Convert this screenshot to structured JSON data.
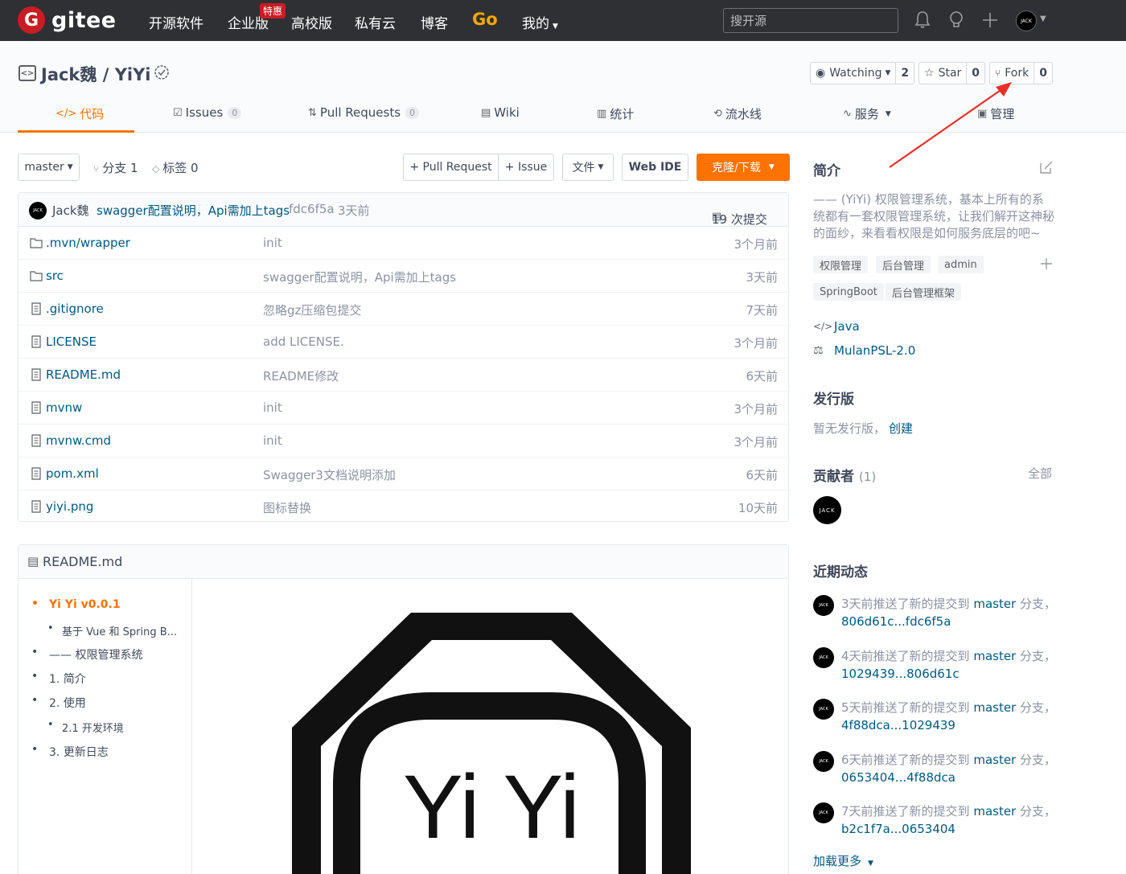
{
  "nav": {
    "logo_text": "gitee",
    "items": [
      "开源软件",
      "企业版",
      "高校版",
      "私有云",
      "博客",
      "Go",
      "我的"
    ],
    "badge": "特惠",
    "search_placeholder": "搜开源",
    "avatar_text": "JACK"
  },
  "repo": {
    "title": "Jack魏 / YiYi",
    "watching_label": "Watching",
    "watching_count": "2",
    "star_label": "Star",
    "star_count": "0",
    "fork_label": "Fork",
    "fork_count": "0"
  },
  "tabs": [
    {
      "label": "代码",
      "icon": "</>"
    },
    {
      "label": "Issues",
      "count": "0"
    },
    {
      "label": "Pull Requests",
      "count": "0"
    },
    {
      "label": "Wiki"
    },
    {
      "label": "统计"
    },
    {
      "label": "流水线"
    },
    {
      "label": "服务"
    },
    {
      "label": "管理"
    }
  ],
  "toolbar": {
    "branch": "master",
    "branches": "分支 1",
    "tags": "标签 0",
    "pull_request": "+ Pull Request",
    "issue": "+ Issue",
    "file": "文件",
    "web_ide": "Web IDE",
    "clone": "克隆/下载"
  },
  "commit": {
    "author": "Jack魏",
    "message": "swagger配置说明，Api需加上tags",
    "hash": "fdc6f5a",
    "time": "3天前",
    "count": "19 次提交"
  },
  "files": [
    {
      "type": "folder",
      "name": ".mvn/wrapper",
      "message": "init",
      "time": "3个月前"
    },
    {
      "type": "folder",
      "name": "src",
      "message": "swagger配置说明，Api需加上tags",
      "time": "3天前"
    },
    {
      "type": "file",
      "name": ".gitignore",
      "message": "忽略gz压缩包提交",
      "time": "7天前"
    },
    {
      "type": "file",
      "name": "LICENSE",
      "message": "add LICENSE.",
      "time": "3个月前"
    },
    {
      "type": "file",
      "name": "README.md",
      "message": "README修改",
      "time": "6天前"
    },
    {
      "type": "file",
      "name": "mvnw",
      "message": "init",
      "time": "3个月前"
    },
    {
      "type": "file",
      "name": "mvnw.cmd",
      "message": "init",
      "time": "3个月前"
    },
    {
      "type": "file",
      "name": "pom.xml",
      "message": "Swagger3文档说明添加",
      "time": "6天前"
    },
    {
      "type": "file",
      "name": "yiyi.png",
      "message": "图标替换",
      "time": "10天前"
    }
  ],
  "readme": {
    "title": "README.md",
    "toc": [
      {
        "label": "Yi Yi v0.0.1",
        "level": 1,
        "active": true
      },
      {
        "label": "基于 Vue 和 Spring B...",
        "level": 2
      },
      {
        "label": "—— 权限管理系统",
        "level": 1
      },
      {
        "label": "1. 简介",
        "level": 1
      },
      {
        "label": "2. 使用",
        "level": 1
      },
      {
        "label": "2.1 开发环境",
        "level": 2
      },
      {
        "label": "3. 更新日志",
        "level": 1
      }
    ],
    "image_text": "Yi Yi"
  },
  "sidebar": {
    "intro_title": "简介",
    "intro": "—— (YiYi) 权限管理系统，基本上所有的系统都有一套权限管理系统，让我们解开这神秘的面纱，来看看权限是如何服务底层的吧~",
    "tags": [
      "权限管理",
      "后台管理",
      "admin",
      "SpringBoot",
      "后台管理框架"
    ],
    "language": "Java",
    "license": "MulanPSL-2.0",
    "release_title": "发行版",
    "release_text": "暂无发行版，",
    "release_create": "创建",
    "contrib_title": "贡献者",
    "contrib_count": "(1)",
    "contrib_all": "全部",
    "contrib_avatar": "JACK",
    "activity_title": "近期动态",
    "activities": [
      {
        "prefix": "3天前推送了新的提交到 ",
        "branch": "master",
        "mid": " 分支，",
        "range": "806d61c...fdc6f5a"
      },
      {
        "prefix": "4天前推送了新的提交到 ",
        "branch": "master",
        "mid": " 分支，",
        "range": "1029439...806d61c"
      },
      {
        "prefix": "5天前推送了新的提交到 ",
        "branch": "master",
        "mid": " 分支，",
        "range": "4f88dca...1029439"
      },
      {
        "prefix": "6天前推送了新的提交到 ",
        "branch": "master",
        "mid": " 分支，",
        "range": "0653404...4f88dca"
      },
      {
        "prefix": "7天前推送了新的提交到 ",
        "branch": "master",
        "mid": " 分支，",
        "range": "b2c1f7a...0653404"
      }
    ],
    "load_more": "加载更多"
  },
  "colors": {
    "accent": "#fe7300",
    "nav_bg": "#2e3033",
    "link": "#005980",
    "brand_red": "#c71d23"
  }
}
